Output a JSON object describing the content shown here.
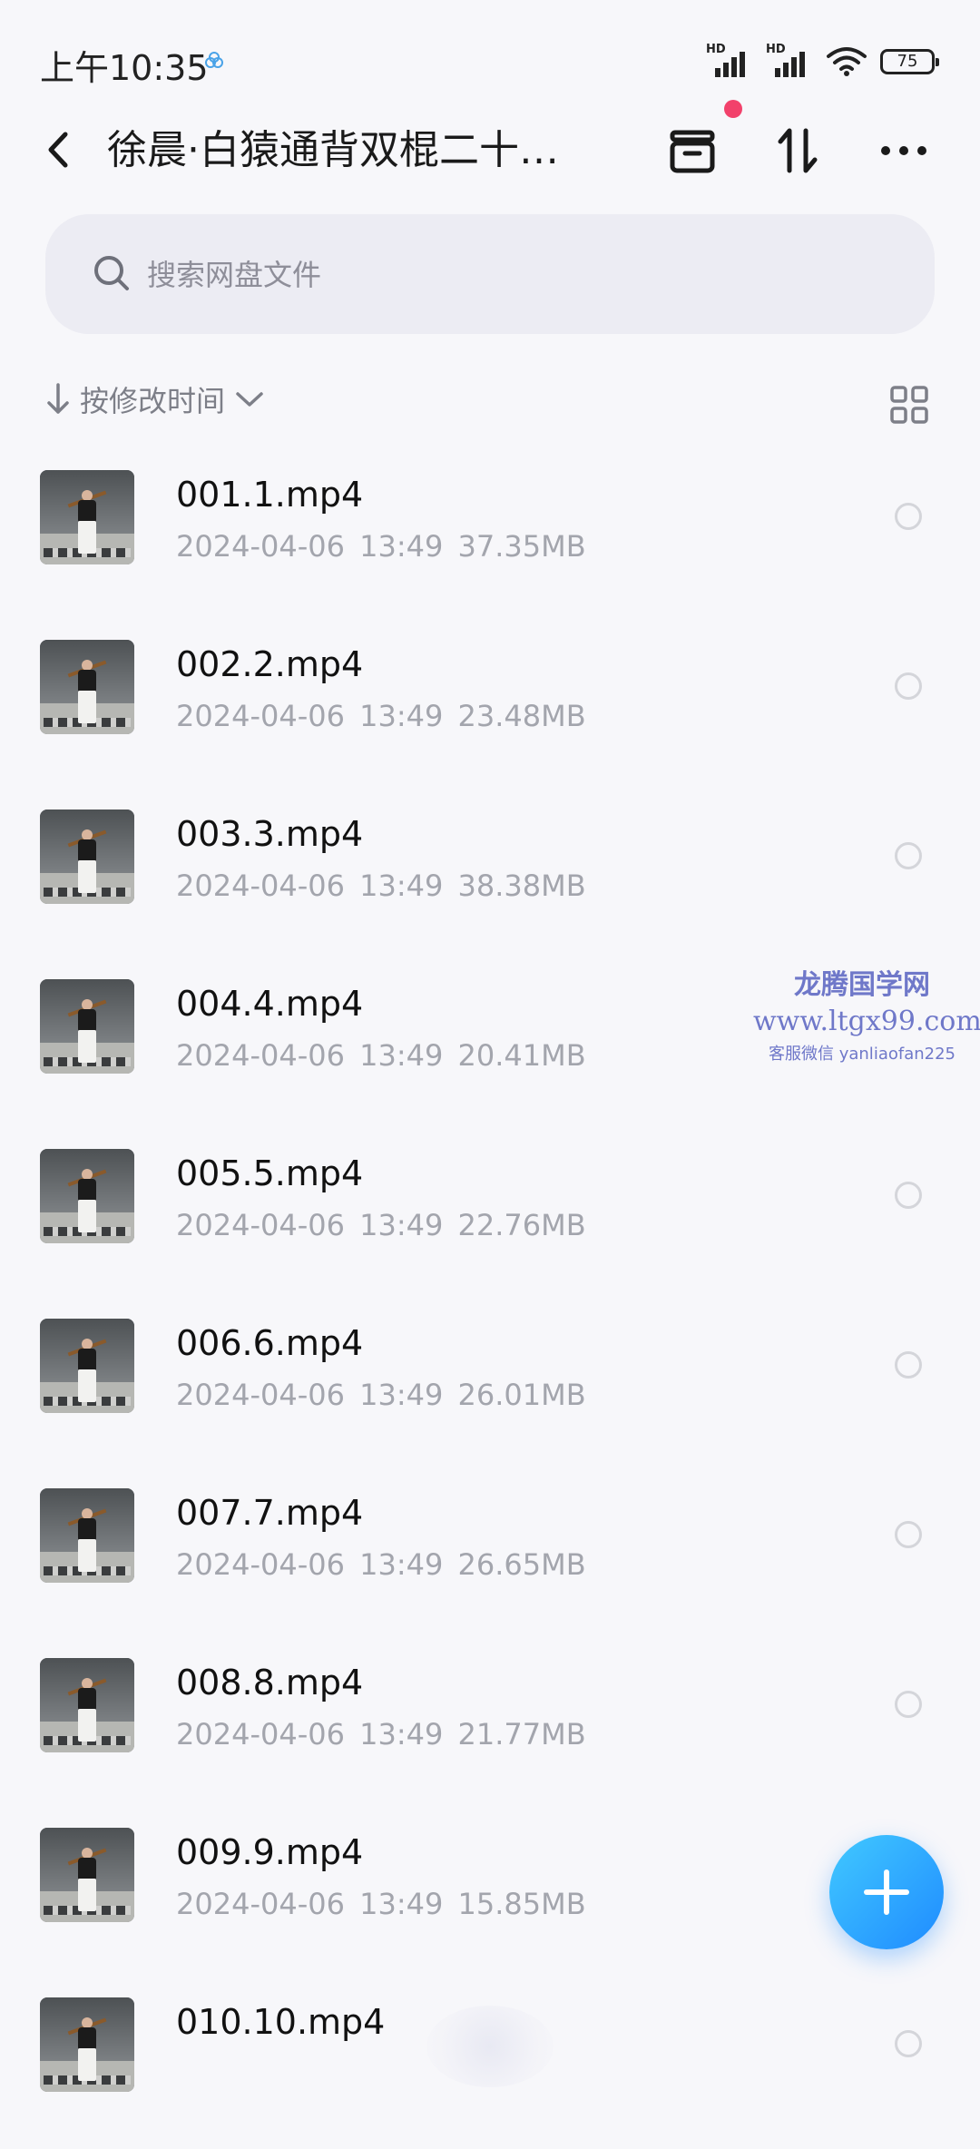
{
  "status_bar": {
    "time": "上午10:35",
    "signal_1_label": "HD",
    "signal_2_label": "HD",
    "battery": "75"
  },
  "header": {
    "title": "徐晨·白猿通背双棍二十…",
    "notification_dot_color": "#f2416b"
  },
  "search": {
    "placeholder": "搜索网盘文件"
  },
  "sort": {
    "label": "按修改时间"
  },
  "files": [
    {
      "name": "001.1.mp4",
      "date": "2024-04-06",
      "time": "13:49",
      "size": "37.35MB"
    },
    {
      "name": "002.2.mp4",
      "date": "2024-04-06",
      "time": "13:49",
      "size": "23.48MB"
    },
    {
      "name": "003.3.mp4",
      "date": "2024-04-06",
      "time": "13:49",
      "size": "38.38MB"
    },
    {
      "name": "004.4.mp4",
      "date": "2024-04-06",
      "time": "13:49",
      "size": "20.41MB"
    },
    {
      "name": "005.5.mp4",
      "date": "2024-04-06",
      "time": "13:49",
      "size": "22.76MB"
    },
    {
      "name": "006.6.mp4",
      "date": "2024-04-06",
      "time": "13:49",
      "size": "26.01MB"
    },
    {
      "name": "007.7.mp4",
      "date": "2024-04-06",
      "time": "13:49",
      "size": "26.65MB"
    },
    {
      "name": "008.8.mp4",
      "date": "2024-04-06",
      "time": "13:49",
      "size": "21.77MB"
    },
    {
      "name": "009.9.mp4",
      "date": "2024-04-06",
      "time": "13:49",
      "size": "15.85MB"
    },
    {
      "name": "010.10.mp4",
      "date": "",
      "time": "",
      "size": ""
    }
  ],
  "watermark": {
    "line1": "龙腾国学网",
    "line2": "www.ltgx99.com",
    "line3": "客服微信 yanliaofan225"
  },
  "fab": {
    "icon": "plus-icon",
    "color": "#1f8bff"
  }
}
